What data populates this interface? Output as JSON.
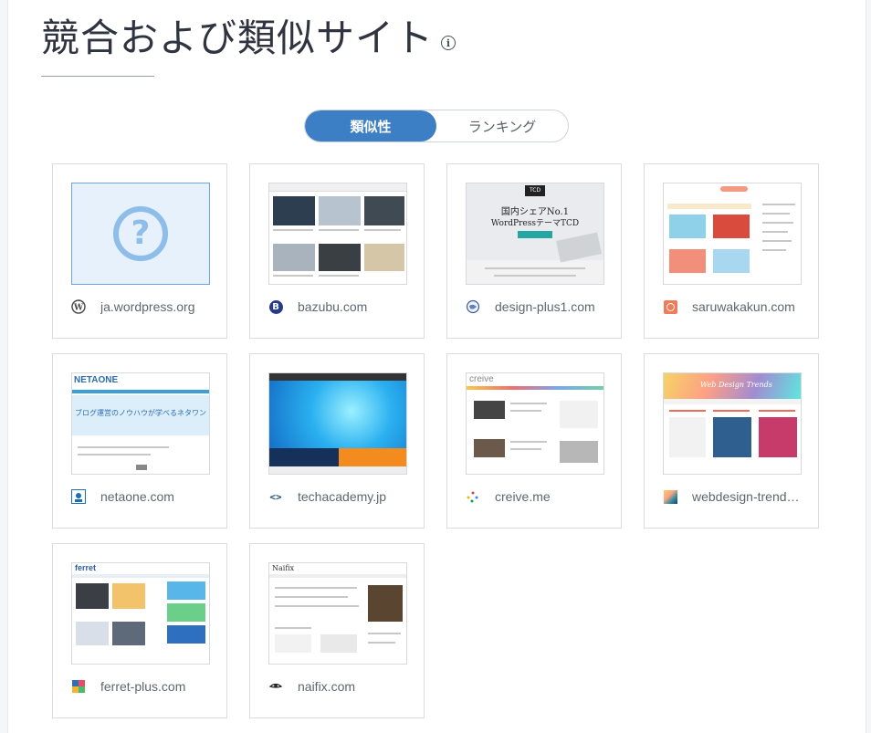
{
  "page": {
    "title": "競合および類似サイト",
    "info_icon": "i"
  },
  "toggle": {
    "active_label": "類似性",
    "inactive_label": "ランキング",
    "active_color": "#3d7fc4"
  },
  "sites": [
    {
      "domain": "ja.wordpress.org",
      "favicon": "wordpress-icon",
      "thumb_symbol": "?"
    },
    {
      "domain": "bazubu.com",
      "favicon": "bazubu-icon",
      "favicon_text": "B"
    },
    {
      "domain": "design-plus1.com",
      "favicon": "globe-icon",
      "thumb_badge": "TCD",
      "thumb_line1": "国内シェアNo.1",
      "thumb_line2": "WordPressテーマTCD"
    },
    {
      "domain": "saruwakakun.com",
      "favicon": "saruwakakun-icon"
    },
    {
      "domain": "netaone.com",
      "favicon": "netaone-icon",
      "thumb_logo": "NETAONE",
      "thumb_banner": "ブログ運営のノウハウが学べるネタワン"
    },
    {
      "domain": "techacademy.jp",
      "favicon": "code-brackets-icon",
      "favicon_text": "<>"
    },
    {
      "domain": "creive.me",
      "favicon": "sparkle-icon",
      "thumb_logo": "creive"
    },
    {
      "domain": "webdesign-trends.net",
      "favicon": "webdesign-trends-icon",
      "thumb_banner": "Web Design Trends"
    },
    {
      "domain": "ferret-plus.com",
      "favicon": "ferret-icon",
      "thumb_logo": "ferret"
    },
    {
      "domain": "naifix.com",
      "favicon": "eye-icon",
      "thumb_logo": "Naifix"
    }
  ]
}
